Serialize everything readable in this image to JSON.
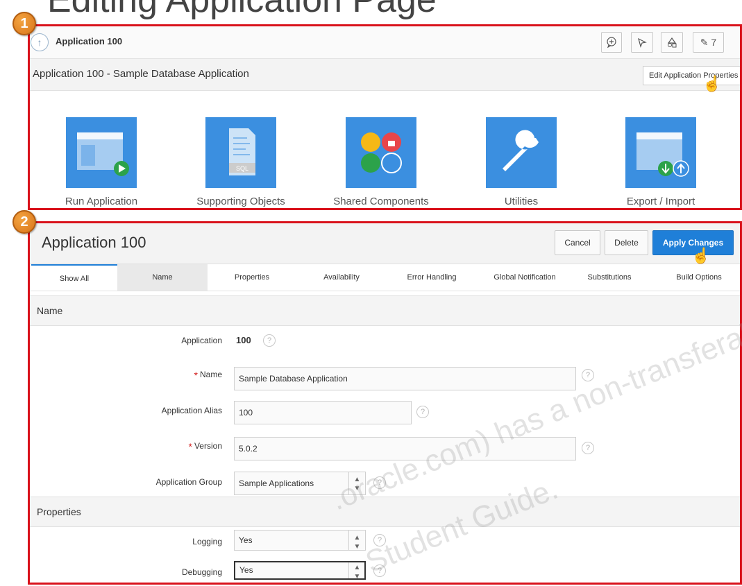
{
  "slide": {
    "title_fragment": "Editing Application Page"
  },
  "callouts": [
    "1",
    "2"
  ],
  "panel1": {
    "breadcrumb": "Application 100",
    "toolbar": {
      "edit_count": "7"
    },
    "page_title": "Application 100 - Sample Database Application",
    "tooltip": "Edit Application Properties",
    "tiles": [
      {
        "label": "Run Application",
        "icon": "run-application-icon"
      },
      {
        "label": "Supporting Objects",
        "icon": "sql-script-icon"
      },
      {
        "label": "Shared Components",
        "icon": "shared-components-icon"
      },
      {
        "label": "Utilities",
        "icon": "wrench-icon"
      },
      {
        "label": "Export / Import",
        "icon": "export-import-icon"
      }
    ]
  },
  "panel2": {
    "title": "Application 100",
    "buttons": {
      "cancel": "Cancel",
      "delete": "Delete",
      "apply": "Apply Changes"
    },
    "tabs": [
      "Show All",
      "Name",
      "Properties",
      "Availability",
      "Error Handling",
      "Global Notification",
      "Substitutions",
      "Build Options"
    ],
    "sections": {
      "name": {
        "label": "Name",
        "application_label": "Application",
        "application_value": "100",
        "name_label": "Name",
        "name_value": "Sample Database Application",
        "alias_label": "Application Alias",
        "alias_value": "100",
        "version_label": "Version",
        "version_value": "5.0.2",
        "group_label": "Application Group",
        "group_value": "Sample Applications"
      },
      "properties": {
        "label": "Properties",
        "logging_label": "Logging",
        "logging_value": "Yes",
        "debugging_label": "Debugging",
        "debugging_value": "Yes"
      }
    }
  },
  "watermark": {
    "line1": ".oracle.com) has a non-transferab",
    "line2": "Student Guide."
  },
  "colors": {
    "callout": "#e0821f",
    "highlight_border": "#d9121b",
    "primary": "#1f7fd8",
    "tile": "#3b8fe0"
  }
}
